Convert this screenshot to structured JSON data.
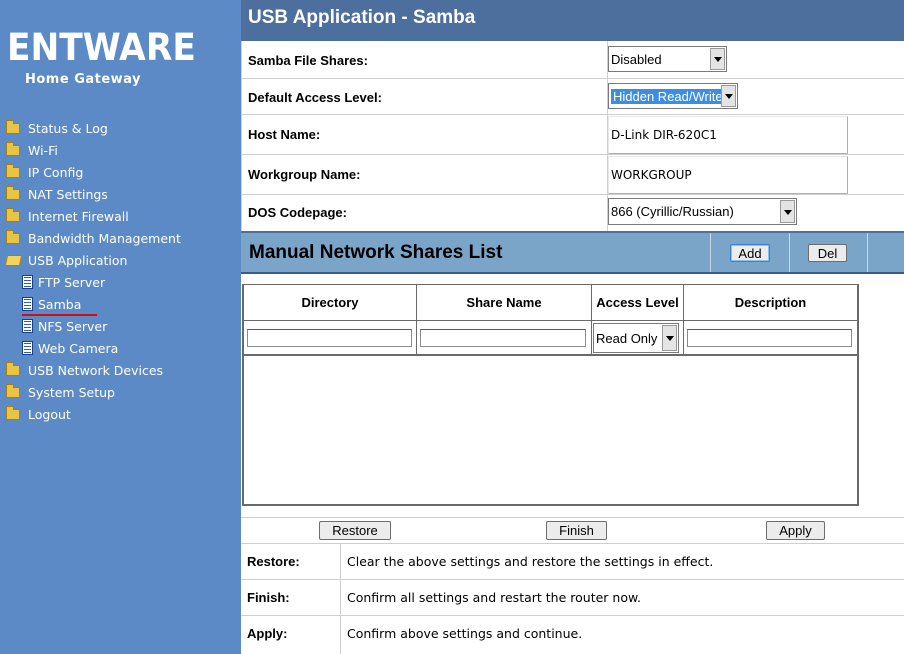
{
  "sidebar": {
    "logo_title": "ENTWARE",
    "logo_subtitle": "Home Gateway",
    "items": [
      {
        "label": "Status & Log",
        "icon": "folder-icon"
      },
      {
        "label": "Wi-Fi",
        "icon": "folder-icon"
      },
      {
        "label": "IP Config",
        "icon": "folder-icon"
      },
      {
        "label": "NAT Settings",
        "icon": "folder-icon"
      },
      {
        "label": "Internet Firewall",
        "icon": "folder-icon"
      },
      {
        "label": "Bandwidth Management",
        "icon": "folder-icon"
      },
      {
        "label": "USB Application",
        "icon": "folder-open-icon"
      },
      {
        "label": "FTP Server",
        "icon": "doc-icon"
      },
      {
        "label": "Samba",
        "icon": "doc-icon",
        "active": true
      },
      {
        "label": "NFS Server",
        "icon": "doc-icon"
      },
      {
        "label": "Web Camera",
        "icon": "doc-icon"
      },
      {
        "label": "USB Network Devices",
        "icon": "folder-icon"
      },
      {
        "label": "System Setup",
        "icon": "folder-icon"
      },
      {
        "label": "Logout",
        "icon": "folder-icon"
      }
    ]
  },
  "header": {
    "title": "USB Application - Samba"
  },
  "form": {
    "samba_shares": {
      "label": "Samba File Shares:",
      "value": "Disabled"
    },
    "access_level": {
      "label": "Default Access Level:",
      "value": "Hidden Read/Write"
    },
    "host_name": {
      "label": "Host Name:",
      "value": "D-Link DIR-620C1"
    },
    "workgroup": {
      "label": "Workgroup Name:",
      "value": "WORKGROUP"
    },
    "codepage": {
      "label": "DOS Codepage:",
      "value": "866 (Cyrillic/Russian)"
    }
  },
  "shares": {
    "title": "Manual Network Shares List",
    "add_label": "Add",
    "del_label": "Del",
    "columns": [
      "Directory",
      "Share Name",
      "Access Level",
      "Description"
    ],
    "new_row": {
      "directory": "",
      "share_name": "",
      "access_level": "Read Only",
      "description": ""
    }
  },
  "actions": {
    "restore": "Restore",
    "finish": "Finish",
    "apply": "Apply"
  },
  "help": [
    {
      "label": "Restore:",
      "text": "Clear the above settings and restore the settings in effect."
    },
    {
      "label": "Finish:",
      "text": "Confirm all settings and restart the router now."
    },
    {
      "label": "Apply:",
      "text": "Confirm above settings and continue."
    }
  ],
  "colors": {
    "sidebar_bg": "#5b8ac6",
    "header_bg": "#4c6f9e",
    "section_bg": "#7aa4c8",
    "active_marker": "#d01010"
  }
}
